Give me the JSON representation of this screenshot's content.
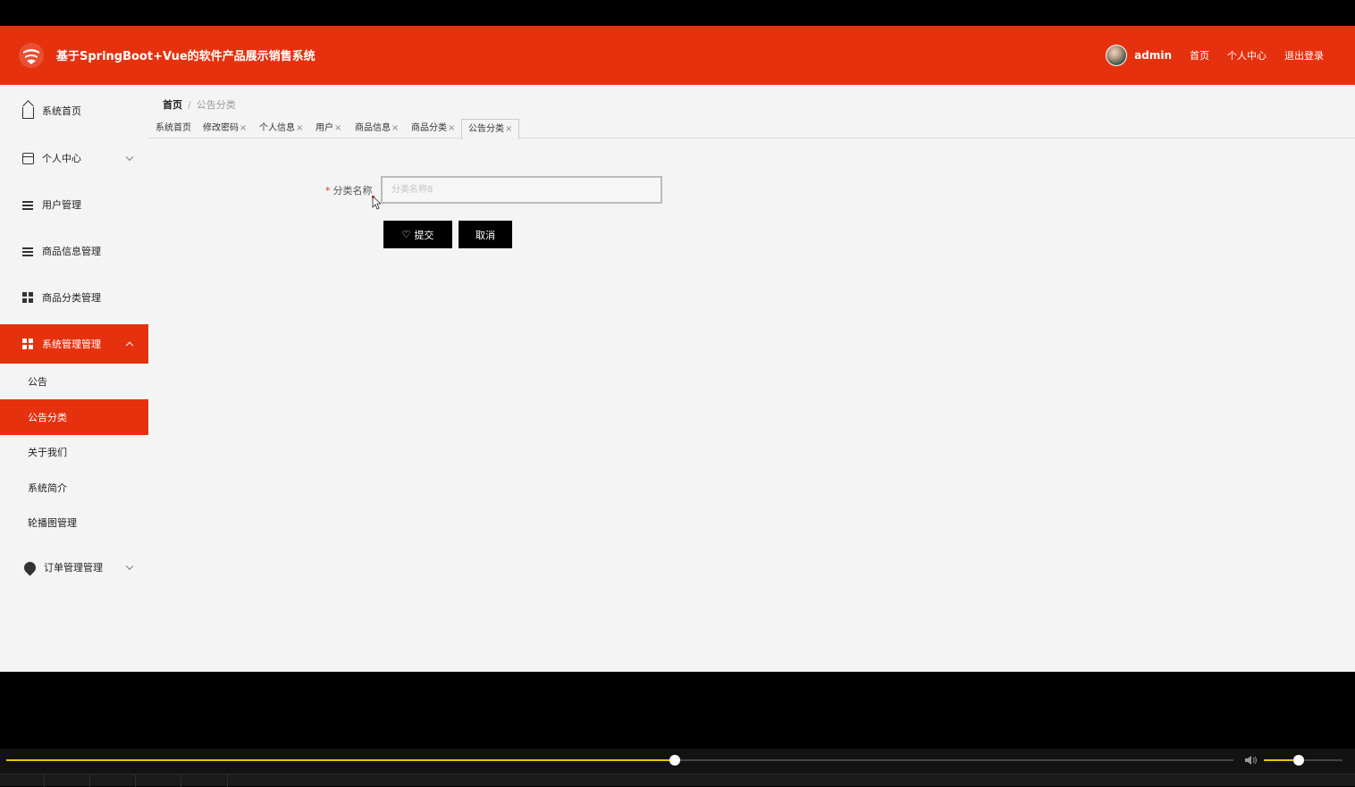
{
  "header": {
    "title": "基于SpringBoot+Vue的软件产品展示销售系统",
    "username": "admin",
    "links": [
      "首页",
      "个人中心",
      "退出登录"
    ]
  },
  "sidebar": {
    "items": [
      {
        "label": "系统首页",
        "icon": "home-icon"
      },
      {
        "label": "个人中心",
        "icon": "card-icon"
      },
      {
        "label": "用户管理",
        "icon": "list-icon"
      },
      {
        "label": "商品信息管理",
        "icon": "list-icon"
      },
      {
        "label": "商品分类管理",
        "icon": "grid-icon"
      },
      {
        "label": "系统管理管理",
        "icon": "grid-icon"
      },
      {
        "label": "订单管理管理",
        "icon": "bulb-icon"
      }
    ],
    "sub_items": [
      "公告",
      "公告分类",
      "关于我们",
      "系统简介",
      "轮播图管理"
    ]
  },
  "breadcrumb": {
    "home": "首页",
    "sep": "/",
    "current": "公告分类"
  },
  "tabs": [
    {
      "label": "系统首页",
      "closable": false
    },
    {
      "label": "修改密码",
      "closable": true
    },
    {
      "label": "个人信息",
      "closable": true
    },
    {
      "label": "用户",
      "closable": true
    },
    {
      "label": "商品信息",
      "closable": true
    },
    {
      "label": "商品分类",
      "closable": true
    },
    {
      "label": "公告分类",
      "closable": true
    }
  ],
  "tab_close": "×",
  "form": {
    "required_mark": "*",
    "field_label": "分类名称",
    "field_placeholder": "分类名称8",
    "submit_label": "提交",
    "cancel_label": "取消"
  },
  "player": {
    "progress_fraction": 0.545,
    "volume_fraction": 0.44,
    "progress_color": "#e8c400"
  },
  "colors": {
    "accent": "#e6310e"
  }
}
